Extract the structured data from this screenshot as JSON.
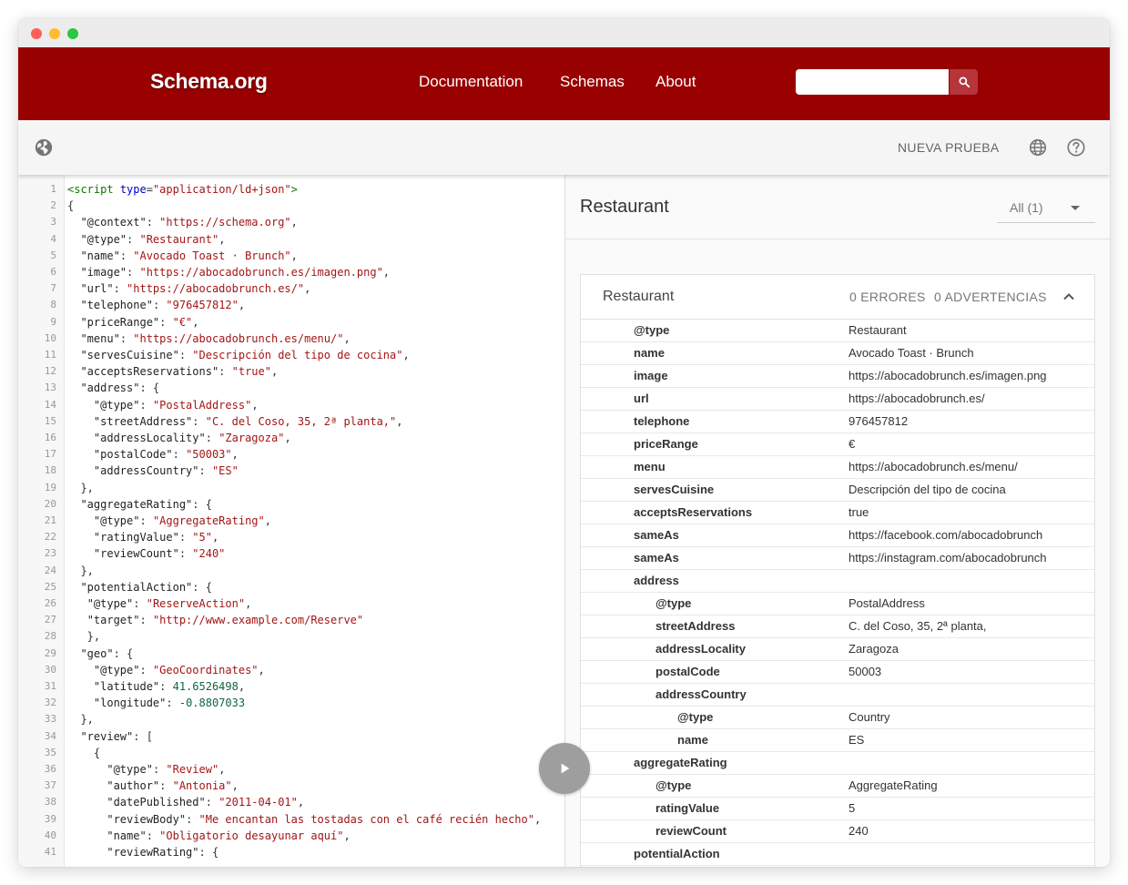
{
  "header": {
    "logo": "Schema.org",
    "nav": [
      "Documentation",
      "Schemas",
      "About"
    ],
    "search_placeholder": ""
  },
  "toolbar": {
    "new_test": "NUEVA PRUEBA"
  },
  "editor": {
    "lines": [
      {
        "n": "1",
        "code": "<script type=\"application/ld+json\">"
      },
      {
        "n": "2",
        "code": "{"
      },
      {
        "n": "3",
        "code": "  \"@context\": \"https://schema.org\","
      },
      {
        "n": "4",
        "code": "  \"@type\": \"Restaurant\","
      },
      {
        "n": "5",
        "code": "  \"name\": \"Avocado Toast · Brunch\","
      },
      {
        "n": "6",
        "code": "  \"image\": \"https://abocadobrunch.es/imagen.png\","
      },
      {
        "n": "7",
        "code": "  \"url\": \"https://abocadobrunch.es/\","
      },
      {
        "n": "8",
        "code": "  \"telephone\": \"976457812\","
      },
      {
        "n": "9",
        "code": "  \"priceRange\": \"€\","
      },
      {
        "n": "10",
        "code": "  \"menu\": \"https://abocadobrunch.es/menu/\","
      },
      {
        "n": "11",
        "code": "  \"servesCuisine\": \"Descripción del tipo de cocina\","
      },
      {
        "n": "12",
        "code": "  \"acceptsReservations\": \"true\","
      },
      {
        "n": "13",
        "code": "  \"address\": {"
      },
      {
        "n": "14",
        "code": "    \"@type\": \"PostalAddress\","
      },
      {
        "n": "15",
        "code": "    \"streetAddress\": \"C. del Coso, 35, 2ª planta,\","
      },
      {
        "n": "16",
        "code": "    \"addressLocality\": \"Zaragoza\","
      },
      {
        "n": "17",
        "code": "    \"postalCode\": \"50003\","
      },
      {
        "n": "18",
        "code": "    \"addressCountry\": \"ES\""
      },
      {
        "n": "19",
        "code": "  },"
      },
      {
        "n": "20",
        "code": "  \"aggregateRating\": {"
      },
      {
        "n": "21",
        "code": "    \"@type\": \"AggregateRating\","
      },
      {
        "n": "22",
        "code": "    \"ratingValue\": \"5\","
      },
      {
        "n": "23",
        "code": "    \"reviewCount\": \"240\""
      },
      {
        "n": "24",
        "code": "  },"
      },
      {
        "n": "25",
        "code": "  \"potentialAction\": {"
      },
      {
        "n": "26",
        "code": "   \"@type\": \"ReserveAction\","
      },
      {
        "n": "27",
        "code": "   \"target\": \"http://www.example.com/Reserve\""
      },
      {
        "n": "28",
        "code": "   },"
      },
      {
        "n": "29",
        "code": "  \"geo\": {"
      },
      {
        "n": "30",
        "code": "    \"@type\": \"GeoCoordinates\","
      },
      {
        "n": "31",
        "code": "    \"latitude\": 41.6526498,"
      },
      {
        "n": "32",
        "code": "    \"longitude\": -0.8807033"
      },
      {
        "n": "33",
        "code": "  },"
      },
      {
        "n": "34",
        "code": "  \"review\": ["
      },
      {
        "n": "35",
        "code": "    {"
      },
      {
        "n": "36",
        "code": "      \"@type\": \"Review\","
      },
      {
        "n": "37",
        "code": "      \"author\": \"Antonia\","
      },
      {
        "n": "38",
        "code": "      \"datePublished\": \"2011-04-01\","
      },
      {
        "n": "39",
        "code": "      \"reviewBody\": \"Me encantan las tostadas con el café recién hecho\","
      },
      {
        "n": "40",
        "code": "      \"name\": \"Obligatorio desayunar aquí\","
      },
      {
        "n": "41",
        "code": "      \"reviewRating\": {"
      }
    ]
  },
  "results": {
    "title": "Restaurant",
    "filter": "All (1)",
    "card": {
      "title": "Restaurant",
      "errors": "0 ERRORES",
      "warnings": "0 ADVERTENCIAS",
      "rows": [
        {
          "level": 0,
          "prop": "@type",
          "value": "Restaurant"
        },
        {
          "level": 0,
          "prop": "name",
          "value": "Avocado Toast · Brunch"
        },
        {
          "level": 0,
          "prop": "image",
          "value": "https://abocadobrunch.es/imagen.png"
        },
        {
          "level": 0,
          "prop": "url",
          "value": "https://abocadobrunch.es/"
        },
        {
          "level": 0,
          "prop": "telephone",
          "value": "976457812"
        },
        {
          "level": 0,
          "prop": "priceRange",
          "value": "€"
        },
        {
          "level": 0,
          "prop": "menu",
          "value": "https://abocadobrunch.es/menu/"
        },
        {
          "level": 0,
          "prop": "servesCuisine",
          "value": "Descripción del tipo de cocina"
        },
        {
          "level": 0,
          "prop": "acceptsReservations",
          "value": "true"
        },
        {
          "level": 0,
          "prop": "sameAs",
          "value": "https://facebook.com/abocadobrunch"
        },
        {
          "level": 0,
          "prop": "sameAs",
          "value": "https://instagram.com/abocadobrunch"
        },
        {
          "level": 0,
          "prop": "address",
          "value": ""
        },
        {
          "level": 1,
          "prop": "@type",
          "value": "PostalAddress"
        },
        {
          "level": 1,
          "prop": "streetAddress",
          "value": "C. del Coso, 35, 2ª planta,"
        },
        {
          "level": 1,
          "prop": "addressLocality",
          "value": "Zaragoza"
        },
        {
          "level": 1,
          "prop": "postalCode",
          "value": "50003"
        },
        {
          "level": 1,
          "prop": "addressCountry",
          "value": ""
        },
        {
          "level": 2,
          "prop": "@type",
          "value": "Country"
        },
        {
          "level": 2,
          "prop": "name",
          "value": "ES"
        },
        {
          "level": 0,
          "prop": "aggregateRating",
          "value": ""
        },
        {
          "level": 1,
          "prop": "@type",
          "value": "AggregateRating"
        },
        {
          "level": 1,
          "prop": "ratingValue",
          "value": "5"
        },
        {
          "level": 1,
          "prop": "reviewCount",
          "value": "240"
        },
        {
          "level": 0,
          "prop": "potentialAction",
          "value": ""
        }
      ]
    }
  },
  "icons": [
    "globe-icon",
    "search-icon",
    "help-icon",
    "play-icon",
    "chevron-up-icon",
    "dropdown-arrow-icon"
  ],
  "colors": {
    "header": "#990000",
    "search_button": "#b5353b",
    "string": "#a31515",
    "number": "#116644"
  }
}
